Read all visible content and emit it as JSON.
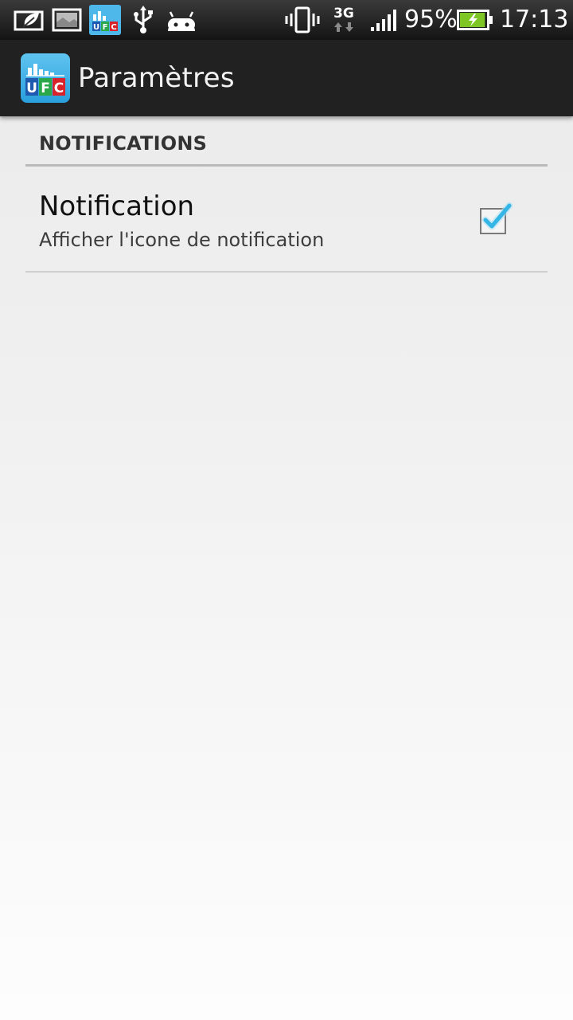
{
  "status_bar": {
    "battery_percent_label": "95%",
    "time": "17:13",
    "network_type": "3G",
    "icons": [
      "battery-saver-leaf-icon",
      "image-notification-icon",
      "ufc-app-notification-icon",
      "usb-icon",
      "android-debug-icon",
      "vibrate-icon",
      "network-3g-icon",
      "signal-strength-icon",
      "battery-charging-icon"
    ],
    "battery_level": 0.95
  },
  "app_logo": {
    "letters": [
      "U",
      "F",
      "C"
    ]
  },
  "action_bar": {
    "title": "Paramètres"
  },
  "preferences": {
    "category_title": "NOTIFICATIONS",
    "items": [
      {
        "title": "Notification",
        "summary": "Afficher l'icone de notification",
        "checked": true
      }
    ]
  },
  "colors": {
    "action_bar_bg": "#212121",
    "checkmark_blue": "#33b5e5",
    "battery_green": "#7dc623"
  }
}
